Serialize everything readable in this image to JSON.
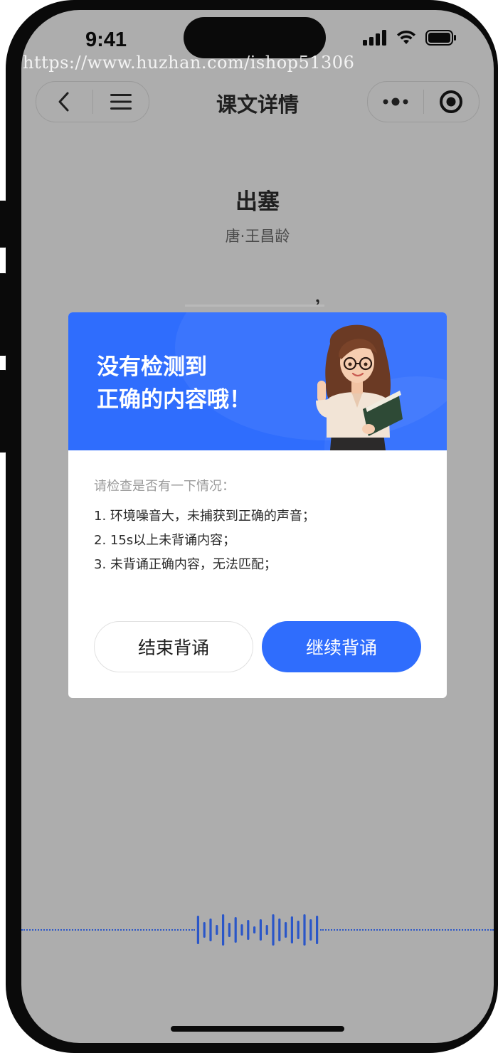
{
  "status_bar": {
    "time": "9:41"
  },
  "watermark": "https://www.huzhan.com/ishop51306",
  "nav": {
    "title": "课文详情",
    "icons": [
      "back-chevron-icon",
      "menu-icon",
      "more-dots-icon",
      "target-icon"
    ]
  },
  "poem": {
    "title": "出塞",
    "author": "唐·王昌龄",
    "comma": "，"
  },
  "modal": {
    "headline_line1": "没有检测到",
    "headline_line2": "正确的内容哦！",
    "prompt": "请检查是否有一下情况：",
    "items": [
      "1. 环境噪音大，未捕获到正确的声音；",
      "2. 15s以上未背诵内容；",
      "3. 未背诵正确内容，无法匹配；"
    ],
    "end_button": "结束背诵",
    "continue_button": "继续背诵",
    "accent_color": "#2f6dfd"
  },
  "recorder": {
    "icon": "audio-waveform-icon",
    "wave_color": "#2a56c8"
  }
}
